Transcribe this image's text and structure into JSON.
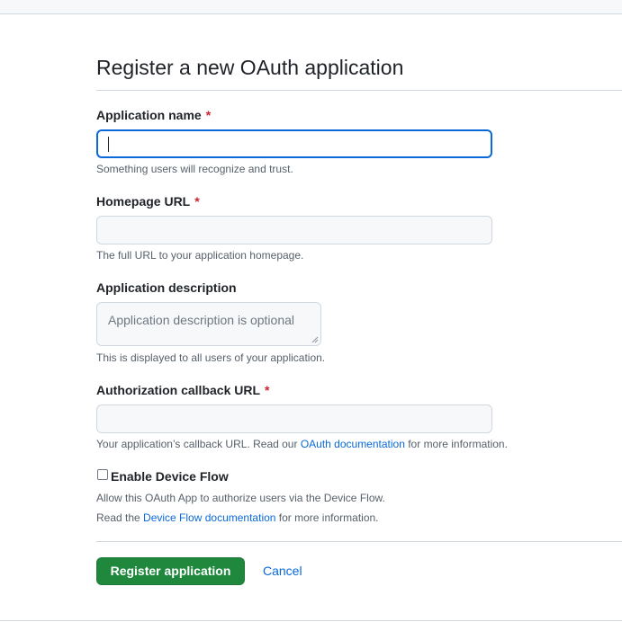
{
  "page": {
    "title": "Register a new OAuth application"
  },
  "form": {
    "required_marker": "*",
    "app_name": {
      "label": "Application name",
      "value": "",
      "hint": "Something users will recognize and trust."
    },
    "homepage_url": {
      "label": "Homepage URL",
      "value": "",
      "hint": "The full URL to your application homepage."
    },
    "description": {
      "label": "Application description",
      "placeholder": "Application description is optional",
      "hint": "This is displayed to all users of your application."
    },
    "callback_url": {
      "label": "Authorization callback URL",
      "value": "",
      "hint_prefix": "Your application’s callback URL. Read our ",
      "hint_link": "OAuth documentation",
      "hint_suffix": " for more information."
    },
    "device_flow": {
      "label": "Enable Device Flow",
      "checked": false,
      "desc_line1": "Allow this OAuth App to authorize users via the Device Flow.",
      "desc_line2_prefix": "Read the ",
      "desc_line2_link": "Device Flow documentation",
      "desc_line2_suffix": " for more information."
    }
  },
  "actions": {
    "register_label": "Register application",
    "cancel_label": "Cancel"
  },
  "colors": {
    "primary": "#1f883d",
    "link": "#0969da",
    "required": "#cf222e",
    "focus": "#0969da"
  }
}
